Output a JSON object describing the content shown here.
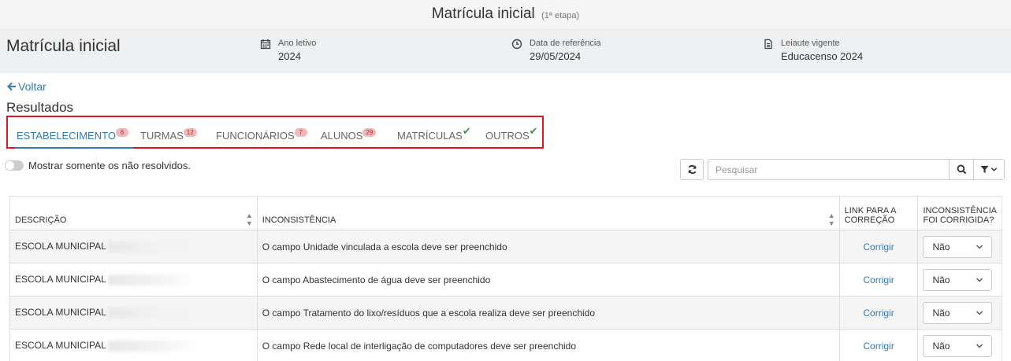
{
  "header": {
    "title": "Matrícula inicial",
    "subtitle": "(1ª etapa)"
  },
  "info": {
    "title": "Matrícula inicial",
    "ano_letivo": {
      "label": "Ano letivo",
      "value": "2024",
      "icon": "calendar-icon"
    },
    "data_referencia": {
      "label": "Data de referência",
      "value": "29/05/2024",
      "icon": "clock-icon"
    },
    "leiaute": {
      "label": "Leiaute vigente",
      "value": "Educacenso 2024",
      "icon": "document-icon"
    }
  },
  "nav": {
    "back_label": "Voltar",
    "section_title": "Resultados"
  },
  "tabs": [
    {
      "label": "ESTABELECIMENTO",
      "badge": "6",
      "active": true
    },
    {
      "label": "TURMAS",
      "badge": "12"
    },
    {
      "label": "FUNCIONÁRIOS",
      "badge": "7"
    },
    {
      "label": "ALUNOS",
      "badge": "29"
    },
    {
      "label": "MATRÍCULAS",
      "check": "✔"
    },
    {
      "label": "OUTROS",
      "check": "✔"
    }
  ],
  "filters": {
    "toggle_label": "Mostrar somente os não resolvidos.",
    "search_placeholder": "Pesquisar"
  },
  "table": {
    "headers": {
      "descricao": "DESCRIÇÃO",
      "inconsistencia": "INCONSISTÊNCIA",
      "link_line1": "LINK PARA A",
      "link_line2": "CORREÇÃO",
      "corrigida_line1": "INCONSISTÊNCIA",
      "corrigida_line2": "FOI CORRIGIDA?"
    },
    "rows": [
      {
        "descricao": "ESCOLA MUNICIPAL",
        "inconsistencia": "O campo Unidade vinculada a escola deve ser preenchido",
        "link": "Corrigir",
        "corrigida": "Não"
      },
      {
        "descricao": "ESCOLA MUNICIPAL",
        "inconsistencia": "O campo Abastecimento de água deve ser preenchido",
        "link": "Corrigir",
        "corrigida": "Não"
      },
      {
        "descricao": "ESCOLA MUNICIPAL",
        "inconsistencia": "O campo Tratamento do lixo/resíduos que a escola realiza deve ser preenchido",
        "link": "Corrigir",
        "corrigida": "Não"
      },
      {
        "descricao": "ESCOLA MUNICIPAL",
        "inconsistencia": "O campo Rede local de interligação de computadores deve ser preenchido",
        "link": "Corrigir",
        "corrigida": "Não"
      }
    ]
  },
  "colors": {
    "accent": "#337ab7",
    "highlight_border": "#e0141e",
    "badge_bg": "#f2b8b8",
    "check": "#3c9a3c"
  }
}
